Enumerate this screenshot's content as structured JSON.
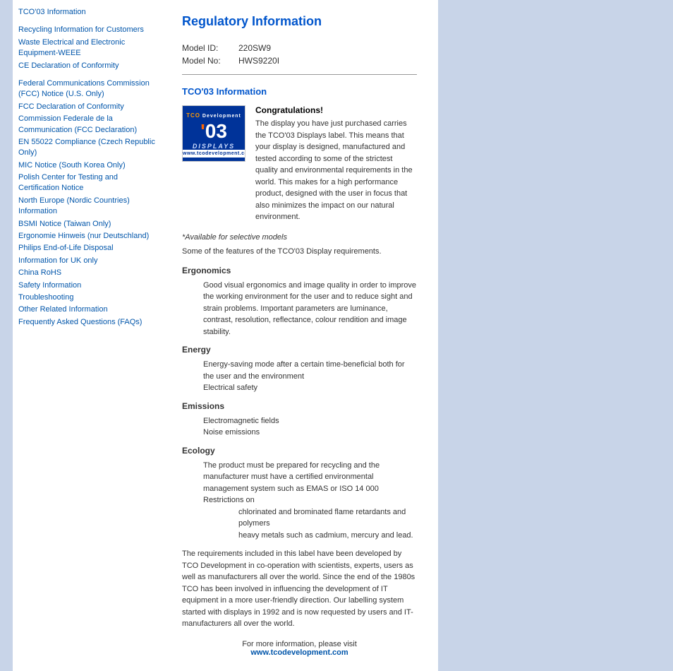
{
  "page": {
    "title": "Regulatory Information"
  },
  "sidebar": {
    "groups": [
      {
        "items": [
          {
            "label": "TCO'03 Information",
            "id": "tco03"
          }
        ]
      },
      {
        "items": [
          {
            "label": "Recycling Information for Customers",
            "id": "recycling"
          },
          {
            "label": "Waste Electrical and Electronic Equipment-WEEE",
            "id": "weee"
          },
          {
            "label": "CE Declaration of Conformity",
            "id": "ce"
          }
        ]
      },
      {
        "items": [
          {
            "label": "Federal Communications Commission (FCC) Notice (U.S. Only)",
            "id": "fcc"
          },
          {
            "label": "FCC Declaration of Conformity",
            "id": "fcc-conformity"
          },
          {
            "label": "Commission Federale de la Communication (FCC Declaration)",
            "id": "fcc-fr"
          },
          {
            "label": "EN 55022 Compliance (Czech Republic Only)",
            "id": "en55022"
          },
          {
            "label": "MIC Notice (South Korea Only)",
            "id": "mic"
          },
          {
            "label": "Polish Center for Testing and Certification Notice",
            "id": "polish"
          },
          {
            "label": "North Europe (Nordic Countries) Information",
            "id": "nordic"
          },
          {
            "label": "BSMI Notice (Taiwan Only)",
            "id": "bsmi"
          },
          {
            "label": "Ergonomie Hinweis (nur Deutschland)",
            "id": "ergonomie"
          },
          {
            "label": "Philips End-of-Life Disposal",
            "id": "eol"
          },
          {
            "label": "Information for UK only",
            "id": "uk"
          },
          {
            "label": "China RoHS",
            "id": "rohs"
          },
          {
            "label": "Safety Information",
            "id": "safety"
          },
          {
            "label": "Troubleshooting",
            "id": "troubleshooting"
          },
          {
            "label": "Other Related Information",
            "id": "other"
          },
          {
            "label": "Frequently Asked Questions (FAQs)",
            "id": "faqs"
          }
        ]
      }
    ]
  },
  "main": {
    "model_id_label": "Model ID:",
    "model_id_value": "220SW9",
    "model_no_label": "Model No:",
    "model_no_value": "HWS9220I",
    "tco_section_title": "TCO'03 Information",
    "tco_logo": {
      "top_text": "TCO Development",
      "big_text": "'03",
      "sub_text": "DISPLAYS",
      "bottom_text": "www.tcodevelopment.com"
    },
    "congratulations_title": "Congratulations!",
    "congratulations_body": "The display you have just purchased carries the TCO'03 Displays label. This means that your display is designed, manufactured and tested according to some of the strictest quality and environmental requirements in the world. This makes for a high performance product, designed with the user in focus that also minimizes the impact on our natural environment.",
    "italic_note": "*Available for selective models",
    "features_text": "Some of the features of the TCO'03 Display requirements.",
    "ergonomics_title": "Ergonomics",
    "ergonomics_body": "Good visual ergonomics and image quality in order to improve the working environment for the user and to reduce sight and strain problems. Important parameters are luminance, contrast, resolution, reflectance, colour rendition and image stability.",
    "energy_title": "Energy",
    "energy_line1": "Energy-saving mode after a certain time-beneficial both for the user and the environment",
    "energy_line2": "Electrical safety",
    "emissions_title": "Emissions",
    "emissions_line1": "Electromagnetic fields",
    "emissions_line2": "Noise emissions",
    "ecology_title": "Ecology",
    "ecology_line1": "The product must be prepared for recycling and the manufacturer must have a certified environmental management system such as EMAS or ISO 14 000",
    "ecology_line2": "Restrictions on",
    "ecology_line3": "chlorinated and brominated flame retardants and polymers",
    "ecology_line4": "heavy metals such as cadmium, mercury and lead.",
    "footer_body": "The requirements included in this label have been developed by TCO Development in co-operation with scientists, experts, users as well as manufacturers all over the world. Since the end of the 1980s TCO has been involved in influencing the development of IT equipment in a more user-friendly direction. Our labelling system started with displays in 1992 and is now requested by users and IT-manufacturers all over the world.",
    "footer_visit": "For more information, please visit",
    "footer_url": "www.tcodevelopment.com"
  }
}
